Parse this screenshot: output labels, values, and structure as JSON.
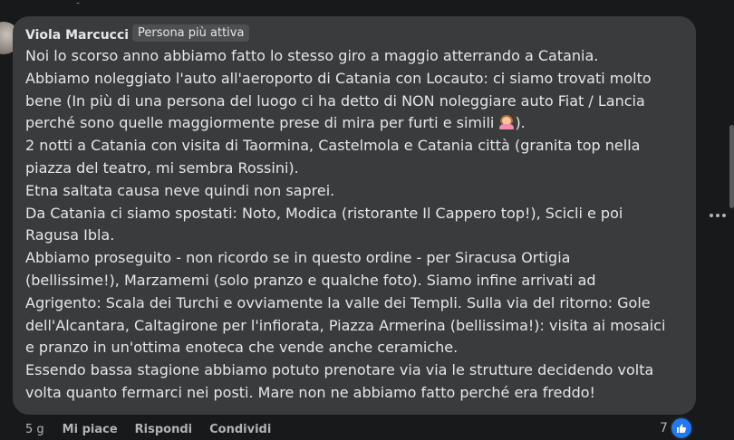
{
  "comment": {
    "author": "Viola Marcucci",
    "badge": "Persona più attiva",
    "lines": [
      "Noi lo scorso anno abbiamo fatto lo stesso giro a maggio atterrando a Catania.",
      "Abbiamo noleggiato l'auto all'aeroporto di Catania con Locauto: ci siamo trovati molto",
      "bene (In più di una persona del luogo ci ha detto di NON noleggiare auto Fiat / Lancia",
      "perché sono quelle maggiormente prese di mira per furti e simili",
      "2 notti a Catania con visita di Taormina, Castelmola e Catania città (granita top nella",
      "piazza del teatro, mi sembra Rossini).",
      "Etna saltata causa neve quindi non saprei.",
      "Da Catania ci siamo spostati: Noto, Modica (ristorante Il Cappero top!), Scicli e poi",
      "Ragusa Ibla.",
      "Abbiamo proseguito - non ricordo se in questo ordine - per Siracusa Ortigia",
      "(bellissime!), Marzamemi (solo pranzo e qualche foto). Siamo infine arrivati ad",
      "Agrigento: Scala dei Turchi e ovviamente la valle dei Templi. Sulla via del ritorno: Gole",
      "dell'Alcantara, Caltagirone per l'infiorata, Piazza Armerina (bellissima!): visita ai mosaici",
      "e pranzo in un'ottima enoteca che vende anche ceramiche.",
      "Essendo bassa stagione abbiamo potuto prenotare via via le strutture decidendo volta",
      "volta quanto fermarci nei posti. Mare non ne abbiamo fatto perché era freddo!"
    ],
    "line4_suffix": ").",
    "emoji_icon": "woman-shrugging-emoji",
    "time": "5 g",
    "actions": {
      "like": "Mi piace",
      "reply": "Rispondi",
      "share": "Condividi"
    },
    "reaction_count": "7",
    "reaction_icon": "like-icon"
  },
  "colors": {
    "background": "#18191a",
    "bubble": "#3a3b3c",
    "text": "#e4e6eb",
    "secondary_text": "#b0b3b8",
    "like_blue": "#2078f4"
  }
}
